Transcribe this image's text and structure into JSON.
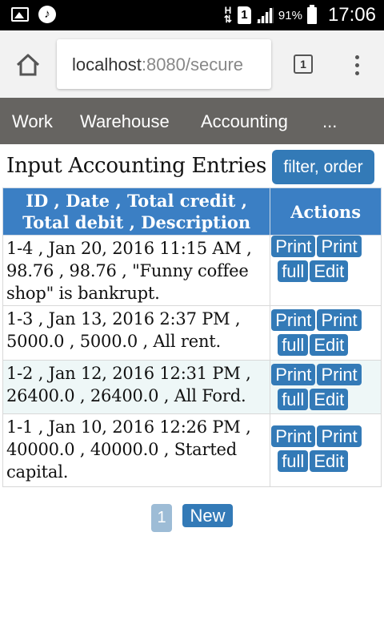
{
  "status_bar": {
    "hplus": "H",
    "sim": "1",
    "battery": "91%",
    "time": "17:06"
  },
  "browser": {
    "url_host": "localhost",
    "url_rest": ":8080/secure",
    "tab_count": "1"
  },
  "nav": {
    "items": [
      "Work",
      "Warehouse",
      "Accounting",
      "..."
    ]
  },
  "page": {
    "title": "Input Accounting Entries",
    "filter_button": "filter, order"
  },
  "table": {
    "header_line1": "ID , Date , Total credit ,",
    "header_line2": "Total debit , Description",
    "actions_header": "Actions",
    "rows": [
      {
        "text": "1-4 , Jan 20, 2016 11:15 AM , 98.76 , 98.76 , \"Funny coffee shop\" is bankrupt."
      },
      {
        "text": "1-3 , Jan 13, 2016 2:37 PM , 5000.0 , 5000.0 , All rent."
      },
      {
        "text": "1-2 , Jan 12, 2016 12:31 PM , 26400.0 , 26400.0 , All Ford."
      },
      {
        "text": "1-1 , Jan 10, 2016 12:26 PM , 40000.0 , 40000.0 , Started capital."
      }
    ],
    "print_label": "Print",
    "print_full_label_a": "Print",
    "print_full_label_b": "full",
    "edit_label": "Edit"
  },
  "pagination": {
    "current_page": "1",
    "new_button": "New"
  },
  "colors": {
    "primary": "#337ab7",
    "header": "#3b7fc4",
    "nav_bg": "#666461",
    "alt_row": "#eef7f7"
  }
}
